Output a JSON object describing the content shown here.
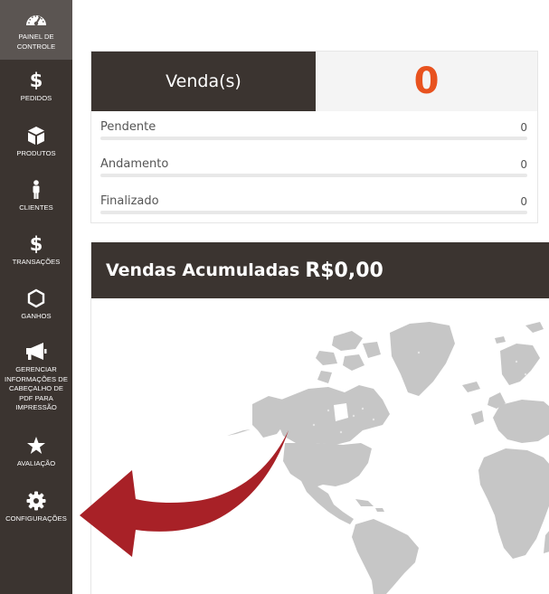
{
  "sidebar": {
    "items": [
      {
        "label": "PAINEL DE CONTROLE",
        "icon": "dashboard-gauge-icon"
      },
      {
        "label": "PEDIDOS",
        "icon": "dollar-icon",
        "glyph": "$"
      },
      {
        "label": "PRODUTOS",
        "icon": "box-icon"
      },
      {
        "label": "CLIENTES",
        "icon": "person-icon"
      },
      {
        "label": "TRANSAÇÕES",
        "icon": "dollar-icon",
        "glyph": "$"
      },
      {
        "label": "GANHOS",
        "icon": "hexagon-icon"
      },
      {
        "label": "GERENCIAR INFORMAÇÕES DE CABEÇALHO DE PDF PARA IMPRESSÃO",
        "icon": "megaphone-icon"
      },
      {
        "label": "AVALIAÇÃO",
        "icon": "star-icon"
      },
      {
        "label": "CONFIGURAÇÕES",
        "icon": "gear-icon"
      }
    ],
    "active_index": 0
  },
  "sales": {
    "header_label": "Venda(s)",
    "count": "0",
    "statuses": [
      {
        "label": "Pendente",
        "value": "0",
        "progress": 0
      },
      {
        "label": "Andamento",
        "value": "0",
        "progress": 0
      },
      {
        "label": "Finalizado",
        "value": "0",
        "progress": 0
      }
    ]
  },
  "accumulated": {
    "title": "Vendas Acumuladas",
    "value": "R$0,00"
  },
  "colors": {
    "sidebar_bg": "#3b3430",
    "active_item_bg": "#5b5552",
    "accent_orange": "#e8521e",
    "arrow_red": "#a82127",
    "map_land": "#c6c6c6"
  }
}
